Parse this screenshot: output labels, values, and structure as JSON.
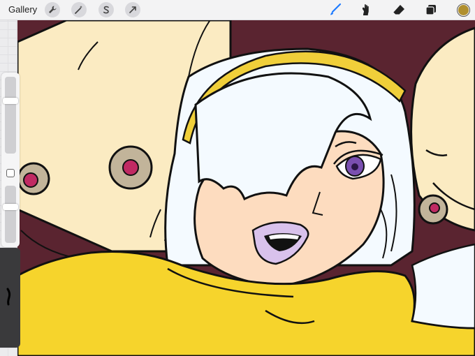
{
  "toolbar": {
    "gallery_label": "Gallery",
    "left_tools": [
      {
        "name": "actions",
        "icon": "wrench-icon"
      },
      {
        "name": "adjustments",
        "icon": "magic-wand-icon"
      },
      {
        "name": "selection",
        "icon": "selection-s-icon"
      },
      {
        "name": "transform",
        "icon": "arrow-cursor-icon"
      }
    ],
    "right_tools": [
      {
        "name": "brush",
        "icon": "brush-icon",
        "active": true
      },
      {
        "name": "smudge",
        "icon": "smudge-icon"
      },
      {
        "name": "eraser",
        "icon": "eraser-icon"
      },
      {
        "name": "layers",
        "icon": "layers-icon"
      }
    ],
    "current_color": "#b08f2e"
  },
  "sidebar": {
    "brush_size": 0.7,
    "opacity": 0.65
  },
  "colors": {
    "accent": "#1e7bff",
    "hair": "#f4faff",
    "skin": "#fddcbf",
    "hood": "#fbebc2",
    "headband": "#f0cf3a",
    "robe": "#f6d42c",
    "lips": "#d9c2ec",
    "eye": "#7a4fb0",
    "background": "#5a2430"
  }
}
